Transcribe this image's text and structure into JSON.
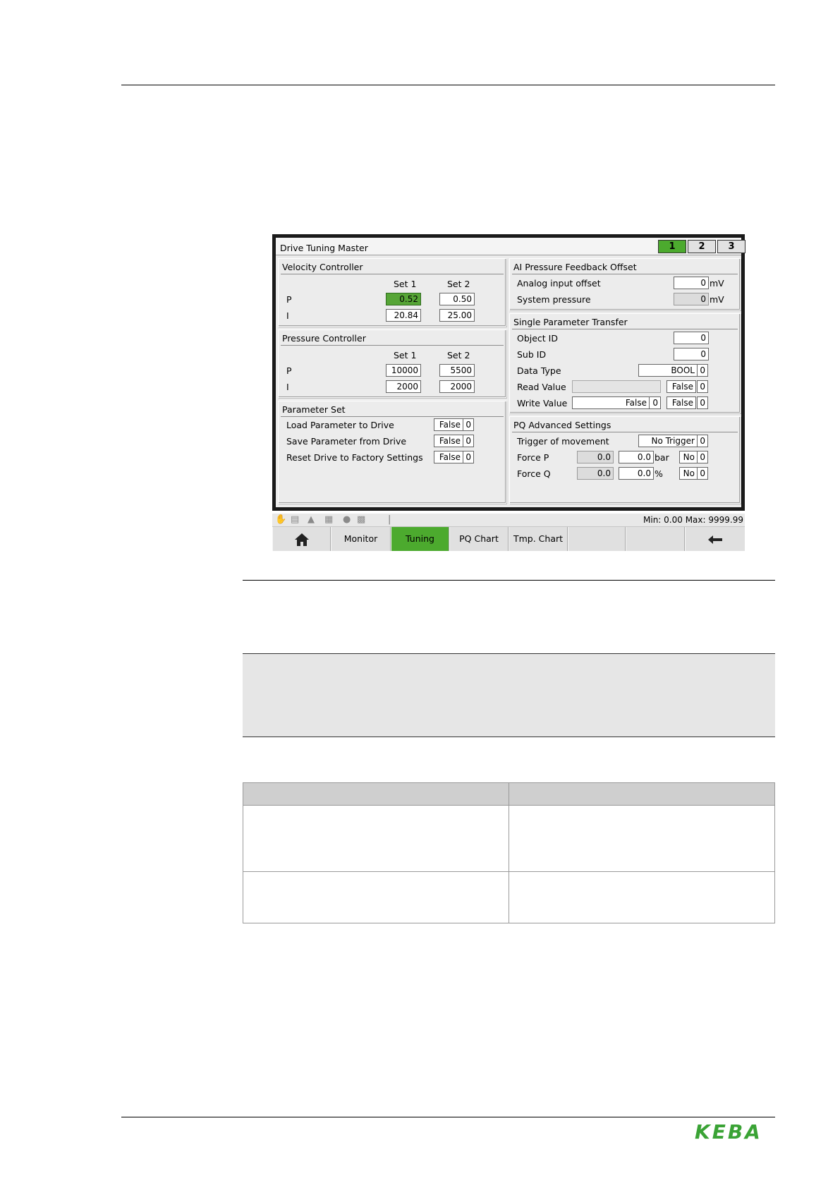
{
  "hmi": {
    "title": "Drive Tuning Master",
    "pages": [
      "1",
      "2",
      "3"
    ],
    "velocity": {
      "header": "Velocity Controller",
      "set1": "Set 1",
      "set2": "Set 2",
      "p_label": "P",
      "i_label": "I",
      "p_set1": "0.52",
      "p_set2": "0.50",
      "i_set1": "20.84",
      "i_set2": "25.00"
    },
    "pressure": {
      "header": "Pressure Controller",
      "set1": "Set 1",
      "set2": "Set 2",
      "p_label": "P",
      "i_label": "I",
      "p_set1": "10000",
      "p_set2": "5500",
      "i_set1": "2000",
      "i_set2": "2000"
    },
    "paramset": {
      "header": "Parameter Set",
      "rows": [
        {
          "label": "Load Parameter to Drive",
          "value": "False",
          "code": "0"
        },
        {
          "label": "Save Parameter from Drive",
          "value": "False",
          "code": "0"
        },
        {
          "label": "Reset Drive to Factory Settings",
          "value": "False",
          "code": "0"
        }
      ]
    },
    "ai_offset": {
      "header": "AI Pressure Feedback Offset",
      "analog_label": "Analog input offset",
      "analog_value": "0",
      "analog_unit": "mV",
      "system_label": "System pressure",
      "system_value": "0",
      "system_unit": "mV"
    },
    "spt": {
      "header": "Single Parameter Transfer",
      "object_label": "Object ID",
      "object_value": "0",
      "sub_label": "Sub ID",
      "sub_value": "0",
      "type_label": "Data Type",
      "type_value": "BOOL",
      "type_code": "0",
      "read_label": "Read Value",
      "read_value": "False",
      "read_code": "0",
      "write_label": "Write Value",
      "write_value": "False",
      "write_code": "0",
      "write_value2": "False",
      "write_code2": "0"
    },
    "pq": {
      "header": "PQ Advanced Settings",
      "trigger_label": "Trigger of movement",
      "trigger_value": "No Trigger",
      "trigger_code": "0",
      "forcep_label": "Force P",
      "forcep_actual": "0.0",
      "forcep_set": "0.0",
      "forcep_unit": "bar",
      "forcep_flag": "No",
      "forcep_code": "0",
      "forceq_label": "Force Q",
      "forceq_actual": "0.0",
      "forceq_set": "0.0",
      "forceq_unit": "%",
      "forceq_flag": "No",
      "forceq_code": "0"
    },
    "status": {
      "minmax": "Min: 0.00 Max: 9999.99"
    },
    "nav": {
      "monitor": "Monitor",
      "tuning": "Tuning",
      "pqchart": "PQ Chart",
      "tmpchart": "Tmp. Chart"
    },
    "colors": {
      "active_green": "#4caa2e"
    }
  },
  "footer": {
    "logo": "KEBA"
  }
}
